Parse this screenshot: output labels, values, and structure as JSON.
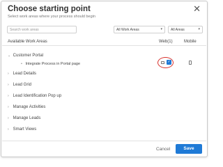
{
  "dialog": {
    "title": "Choose starting point",
    "subtitle": "Select work areas where your process should begin",
    "close_icon": "close-icon"
  },
  "filters": {
    "search_placeholder": "Search work areas",
    "work_area_select": "All Work Areas",
    "area_select": "All Areas"
  },
  "columns": {
    "available": "Available Work Areas",
    "web": "Web(1)",
    "mobile": "Mobile"
  },
  "tree": {
    "expanded": {
      "label": "Customer Portal",
      "child_label": "Integrate Process in Portal page",
      "web_checked": true
    },
    "collapsed": [
      "Lead Details",
      "Lead Grid",
      "Lead Identification Pop up",
      "Manage Activities",
      "Manage Leads",
      "Smart Views"
    ]
  },
  "footer": {
    "cancel": "Cancel",
    "save": "Save"
  },
  "colors": {
    "accent": "#1f7ad6",
    "highlight_ring": "#d8312c"
  }
}
